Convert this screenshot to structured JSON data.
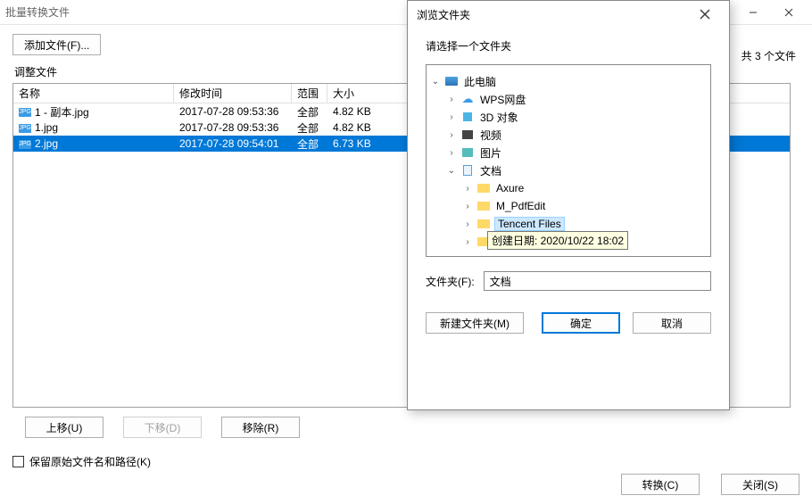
{
  "window": {
    "title": "批量转换文件",
    "add_files_btn": "添加文件(F)...",
    "adjust_label": "调整文件",
    "count_label": "共 3 个文件",
    "columns": {
      "name": "名称",
      "mtime": "修改时间",
      "scope": "范围",
      "size": "大小"
    },
    "rows": [
      {
        "name": "1 - 副本.jpg",
        "mtime": "2017-07-28 09:53:36",
        "scope": "全部",
        "size": "4.82 KB",
        "selected": false
      },
      {
        "name": "1.jpg",
        "mtime": "2017-07-28 09:53:36",
        "scope": "全部",
        "size": "4.82 KB",
        "selected": false
      },
      {
        "name": "2.jpg",
        "mtime": "2017-07-28 09:54:01",
        "scope": "全部",
        "size": "6.73 KB",
        "selected": true
      }
    ],
    "move_up": "上移(U)",
    "move_down": "下移(D)",
    "remove": "移除(R)",
    "keep_original": "保留原始文件名和路径(K)",
    "convert": "转换(C)",
    "close": "关闭(S)"
  },
  "dialog": {
    "title": "浏览文件夹",
    "prompt": "请选择一个文件夹",
    "tree": {
      "root": "此电脑",
      "wps": "WPS网盘",
      "obj3d": "3D 对象",
      "video": "视频",
      "pictures": "图片",
      "documents": "文档",
      "axure": "Axure",
      "mpdf": "M_PdfEdit",
      "tencent": "Tencent Files"
    },
    "tooltip": "创建日期: 2020/10/22 18:02",
    "folder_label": "文件夹(F):",
    "folder_value": "文档",
    "new_folder": "新建文件夹(M)",
    "ok": "确定",
    "cancel": "取消"
  }
}
